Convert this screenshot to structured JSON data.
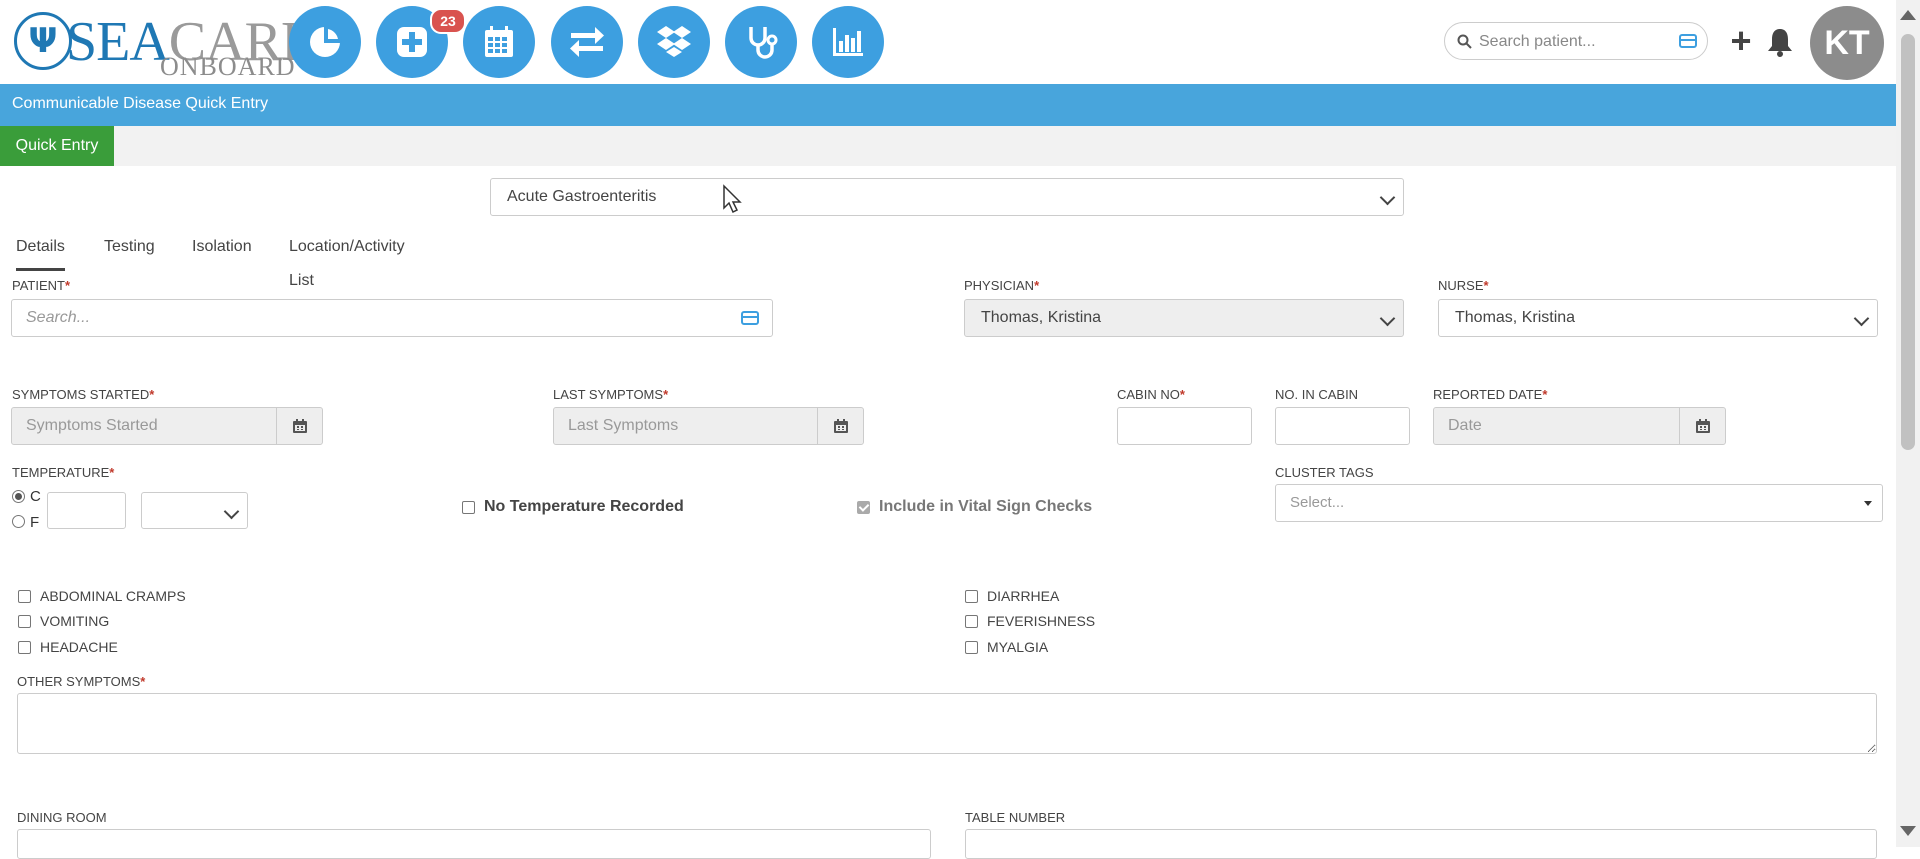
{
  "app": {
    "logo_sea": "SEA",
    "logo_care": "CARE",
    "logo_onboard": "ONBOARD",
    "nav_badge": "23",
    "search_placeholder": "Search patient...",
    "avatar_initials": "KT"
  },
  "page": {
    "title": "Communicable Disease Quick Entry",
    "quick_entry_label": "Quick Entry",
    "disease_selected": "Acute Gastroenteritis"
  },
  "tabs": [
    {
      "label": "Details",
      "active": true
    },
    {
      "label": "Testing"
    },
    {
      "label": "Isolation"
    },
    {
      "label": "Location/Activity List"
    }
  ],
  "form": {
    "patient_label": "PATIENT",
    "patient_placeholder": "Search...",
    "physician_label": "PHYSICIAN",
    "physician_value": "Thomas, Kristina",
    "nurse_label": "NURSE",
    "nurse_value": "Thomas, Kristina",
    "symptoms_started_label": "SYMPTOMS STARTED",
    "symptoms_started_placeholder": "Symptoms Started",
    "last_symptoms_label": "LAST SYMPTOMS",
    "last_symptoms_placeholder": "Last Symptoms",
    "cabin_no_label": "CABIN NO",
    "no_in_cabin_label": "NO. IN CABIN",
    "reported_date_label": "REPORTED DATE",
    "reported_date_placeholder": "Date",
    "temperature_label": "TEMPERATURE",
    "temp_unit_c": "C",
    "temp_unit_f": "F",
    "no_temperature_label": "No Temperature Recorded",
    "include_vitals_label": "Include in Vital Sign Checks",
    "cluster_tags_label": "CLUSTER TAGS",
    "cluster_tags_placeholder": "Select...",
    "symptoms_left": [
      "ABDOMINAL CRAMPS",
      "VOMITING",
      "HEADACHE"
    ],
    "symptoms_right": [
      "DIARRHEA",
      "FEVERISHNESS",
      "MYALGIA"
    ],
    "other_symptoms_label": "OTHER SYMPTOMS",
    "dining_room_label": "DINING ROOM",
    "table_number_label": "TABLE NUMBER"
  },
  "colors": {
    "nav_blue": "#3d9fe0",
    "title_bar": "#48a5dc",
    "quick_entry_green": "#3a9d3a",
    "badge_red": "#d9534f",
    "required_red": "#c0392b"
  },
  "icons": [
    "dashboard-pie-icon",
    "add-medical-icon",
    "calendar-icon",
    "transfer-icon",
    "dropbox-icon",
    "stethoscope-icon",
    "bar-chart-icon",
    "search-icon",
    "card-icon",
    "plus-icon",
    "bell-icon"
  ]
}
